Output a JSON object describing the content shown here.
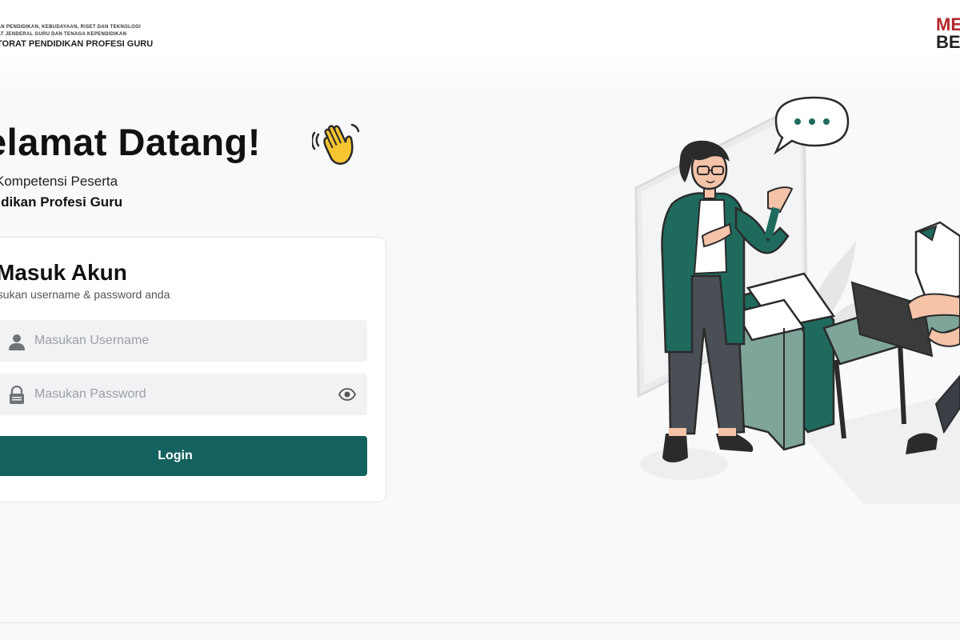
{
  "header": {
    "logo_line1": "DAN PENDIDIKAN, KEBUDAYAAN, RISET DAN TEKNOLOGI",
    "logo_line2": "RAT JENDERAL GURU DAN TENAGA KEPENDIDIKAN",
    "logo_line3": "TORAT PENDIDIKAN PROFESI GURU",
    "brand_line1": "ME",
    "brand_line2": "BE"
  },
  "welcome": {
    "title": "elamat Datang!",
    "wave_icon": "waving-hand-emoji",
    "subtitle1": "Kompetensi Peserta",
    "subtitle2": "didikan Profesi Guru"
  },
  "login": {
    "title": "Masuk Akun",
    "subtitle": "asukan username & password anda",
    "username_placeholder": "Masukan Username",
    "username_value": "",
    "username_icon": "user-icon",
    "password_placeholder": "Masukan Password",
    "password_value": "",
    "password_icon": "lock-icon",
    "toggle_icon": "eye-icon",
    "button_label": "Login"
  },
  "colors": {
    "primary": "#13625f",
    "illustration_accent": "#1e6b5e",
    "background": "#f8f9fa"
  }
}
